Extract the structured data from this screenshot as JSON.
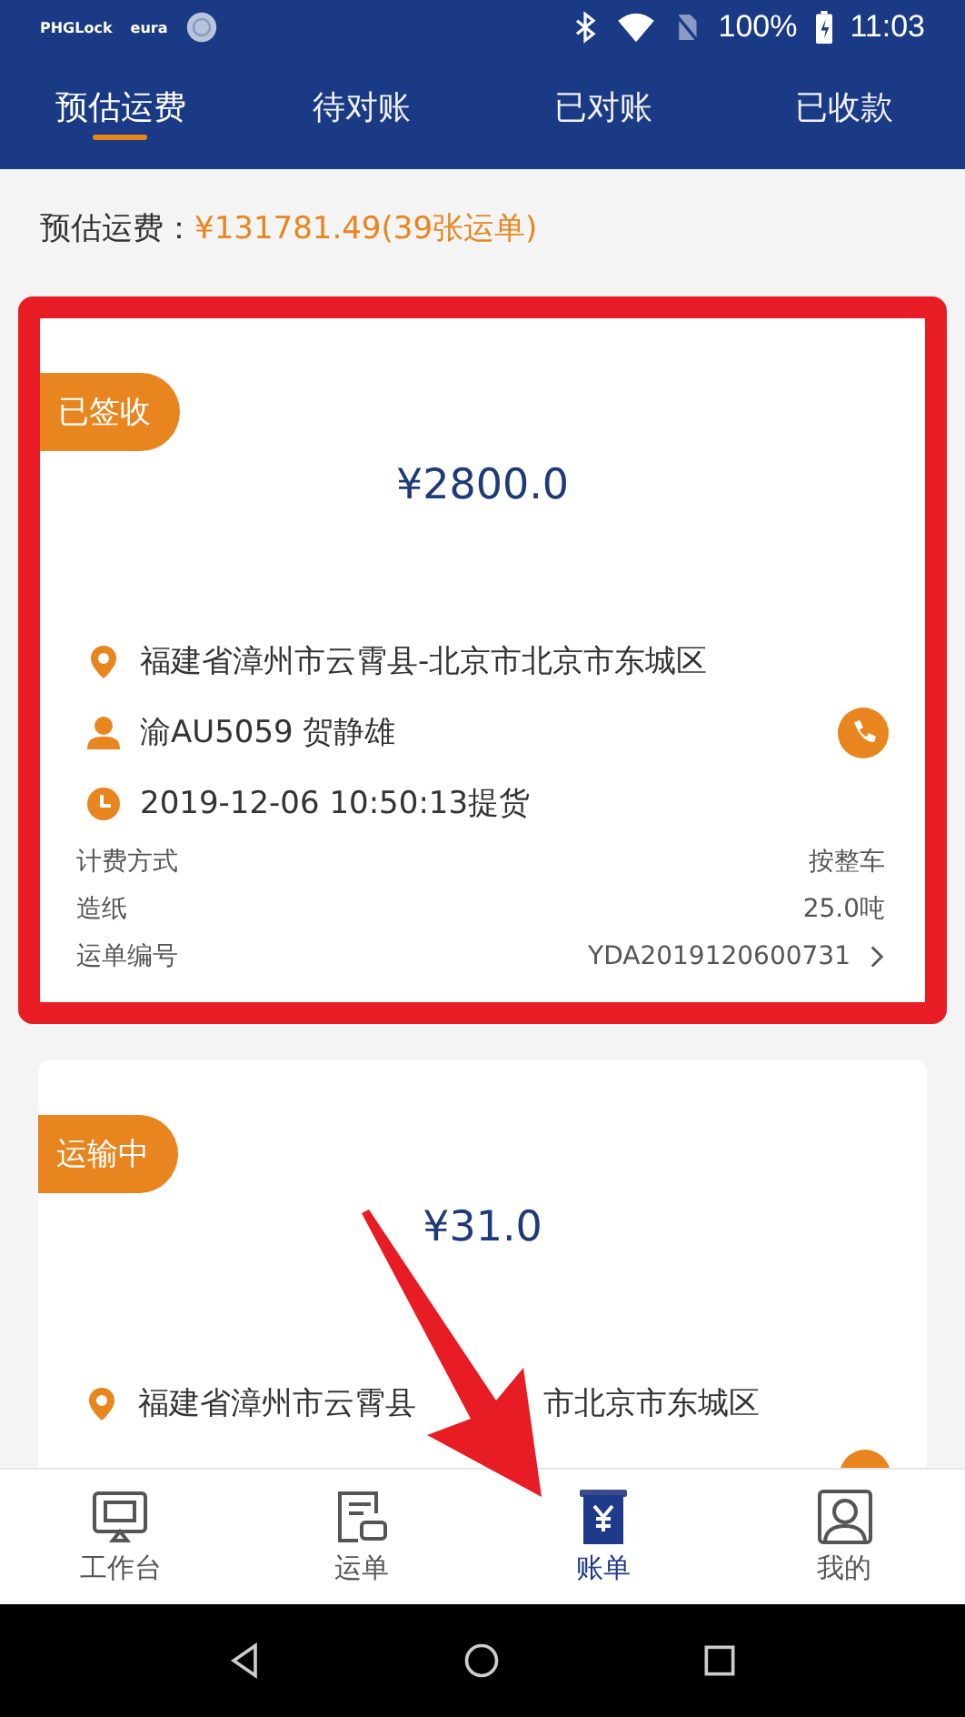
{
  "status_bar": {
    "notifications": [
      "PHGLock",
      "eura"
    ],
    "battery": "100%",
    "time": "11:03"
  },
  "tabs": [
    {
      "label": "预估运费",
      "selected": true
    },
    {
      "label": "待对账",
      "selected": false
    },
    {
      "label": "已对账",
      "selected": false
    },
    {
      "label": "已收款",
      "selected": false
    }
  ],
  "summary": {
    "label": "预估运费：",
    "value": "¥131781.49(39张运单)"
  },
  "cards": [
    {
      "status": "已签收",
      "amount": "¥2800.0",
      "highlighted": true,
      "address": [
        "福建省漳州市云霄县-北京市北京市东城区"
      ],
      "driver": "渝AU5059 贺静雄",
      "time": "2019-12-06 10:50:13提货",
      "details": [
        {
          "label": "计费方式",
          "value": "按整车",
          "link": false
        },
        {
          "label": "造纸",
          "value": "25.0吨",
          "link": false
        },
        {
          "label": "运单编号",
          "value": "YDA2019120600731",
          "link": true
        }
      ]
    },
    {
      "status": "运输中",
      "amount": "¥31.0",
      "highlighted": false,
      "address": [
        "福建省漳州市云霄县",
        "市北京市东城区"
      ]
    }
  ],
  "bottom_nav": [
    {
      "label": "工作台",
      "kind": "desk",
      "selected": false
    },
    {
      "label": "运单",
      "kind": "waybill",
      "selected": false
    },
    {
      "label": "账单",
      "kind": "bill",
      "selected": true
    },
    {
      "label": "我的",
      "kind": "profile",
      "selected": false
    }
  ],
  "annotations": [
    {
      "kind": "arrow"
    }
  ]
}
